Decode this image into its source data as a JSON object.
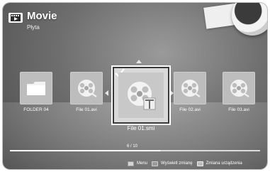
{
  "header": {
    "title": "Movie",
    "subtitle": "Płyta"
  },
  "items": [
    {
      "label": "FOLDER 04",
      "icon": "folder-icon"
    },
    {
      "label": "File 01.avi",
      "icon": "film-reel-icon"
    },
    {
      "label": "File 02.avi",
      "icon": "film-reel-icon"
    },
    {
      "label": "File 03.avi",
      "icon": "film-reel-icon"
    }
  ],
  "selected": {
    "label": "File 01.smi",
    "icon": "film-reel-text-icon"
  },
  "progress": {
    "text": "6 / 10",
    "value": 0.6
  },
  "footer": [
    {
      "label": "Menu"
    },
    {
      "label": "Wyświetl zmianę"
    },
    {
      "label": "Zmiana urządzenia"
    }
  ]
}
